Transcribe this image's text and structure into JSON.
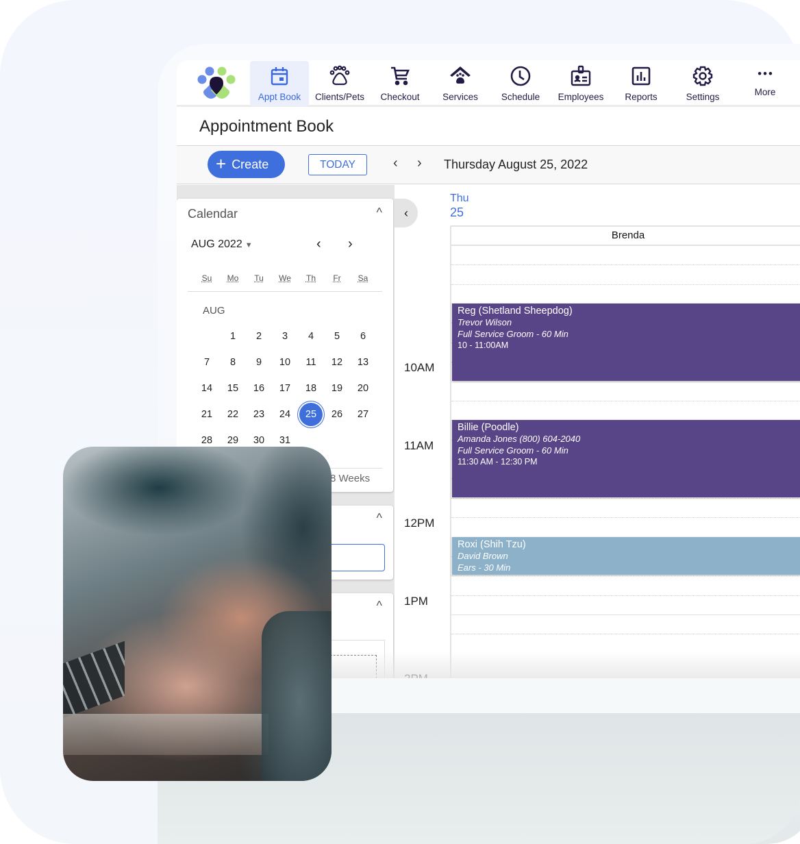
{
  "nav": {
    "items": [
      {
        "label": "Appt Book",
        "icon": "calendar-icon",
        "active": true
      },
      {
        "label": "Clients/Pets",
        "icon": "paw-icon",
        "active": false
      },
      {
        "label": "Checkout",
        "icon": "cart-icon",
        "active": false
      },
      {
        "label": "Services",
        "icon": "house-paw-icon",
        "active": false
      },
      {
        "label": "Schedule",
        "icon": "clock-icon",
        "active": false
      },
      {
        "label": "Employees",
        "icon": "id-badge-icon",
        "active": false
      },
      {
        "label": "Reports",
        "icon": "bar-chart-icon",
        "active": false
      },
      {
        "label": "Settings",
        "icon": "gear-icon",
        "active": false
      },
      {
        "label": "More",
        "icon": "more-dots-icon",
        "active": false
      }
    ]
  },
  "header": {
    "title": "Appointment Book"
  },
  "toolbar": {
    "create_label": "Create",
    "today_label": "TODAY",
    "prev_icon": "‹",
    "next_icon": "›",
    "date": "Thursday August 25, 2022"
  },
  "calendar": {
    "title": "Calendar",
    "collapse_icon": "^",
    "month_select": "AUG 2022",
    "month_label": "AUG",
    "weekdays": [
      "Su",
      "Mo",
      "Tu",
      "We",
      "Th",
      "Fr",
      "Sa"
    ],
    "weeks": [
      [
        "",
        "1",
        "2",
        "3",
        "4",
        "5",
        "6"
      ],
      [
        "7",
        "8",
        "9",
        "10",
        "11",
        "12",
        "13"
      ],
      [
        "14",
        "15",
        "16",
        "17",
        "18",
        "19",
        "20"
      ],
      [
        "21",
        "22",
        "23",
        "24",
        "25",
        "26",
        "27"
      ],
      [
        "28",
        "29",
        "30",
        "31",
        "",
        "",
        ""
      ]
    ],
    "selected_day": "25",
    "weeks_label": "3 Weeks",
    "weeks_partial": "8  Weeks"
  },
  "schedule": {
    "day_dow": "Thu",
    "day_num": "25",
    "staff": "Brenda",
    "times": [
      "10AM",
      "11AM",
      "12PM",
      "1PM",
      "2PM"
    ],
    "appointments": [
      {
        "pet": "Reg (Shetland Sheepdog)",
        "client": "Trevor Wilson",
        "service": "Full Service Groom - 60 Min",
        "time": "10 - 11:00AM",
        "color": "#574587"
      },
      {
        "pet": "Billie (Poodle)",
        "client": "Amanda Jones (800) 604-2040",
        "service": "Full Service Groom - 60 Min",
        "time": "11:30 AM - 12:30 PM",
        "color": "#574587"
      },
      {
        "pet": "Roxi (Shih Tzu)",
        "client": "David Brown",
        "service": "Ears - 30 Min",
        "time": "",
        "color": "#8db1c9"
      }
    ]
  },
  "colors": {
    "accent": "#3f6fdc",
    "nav_text": "#231a45",
    "appt_purple": "#574587",
    "appt_blue": "#8db1c9"
  }
}
